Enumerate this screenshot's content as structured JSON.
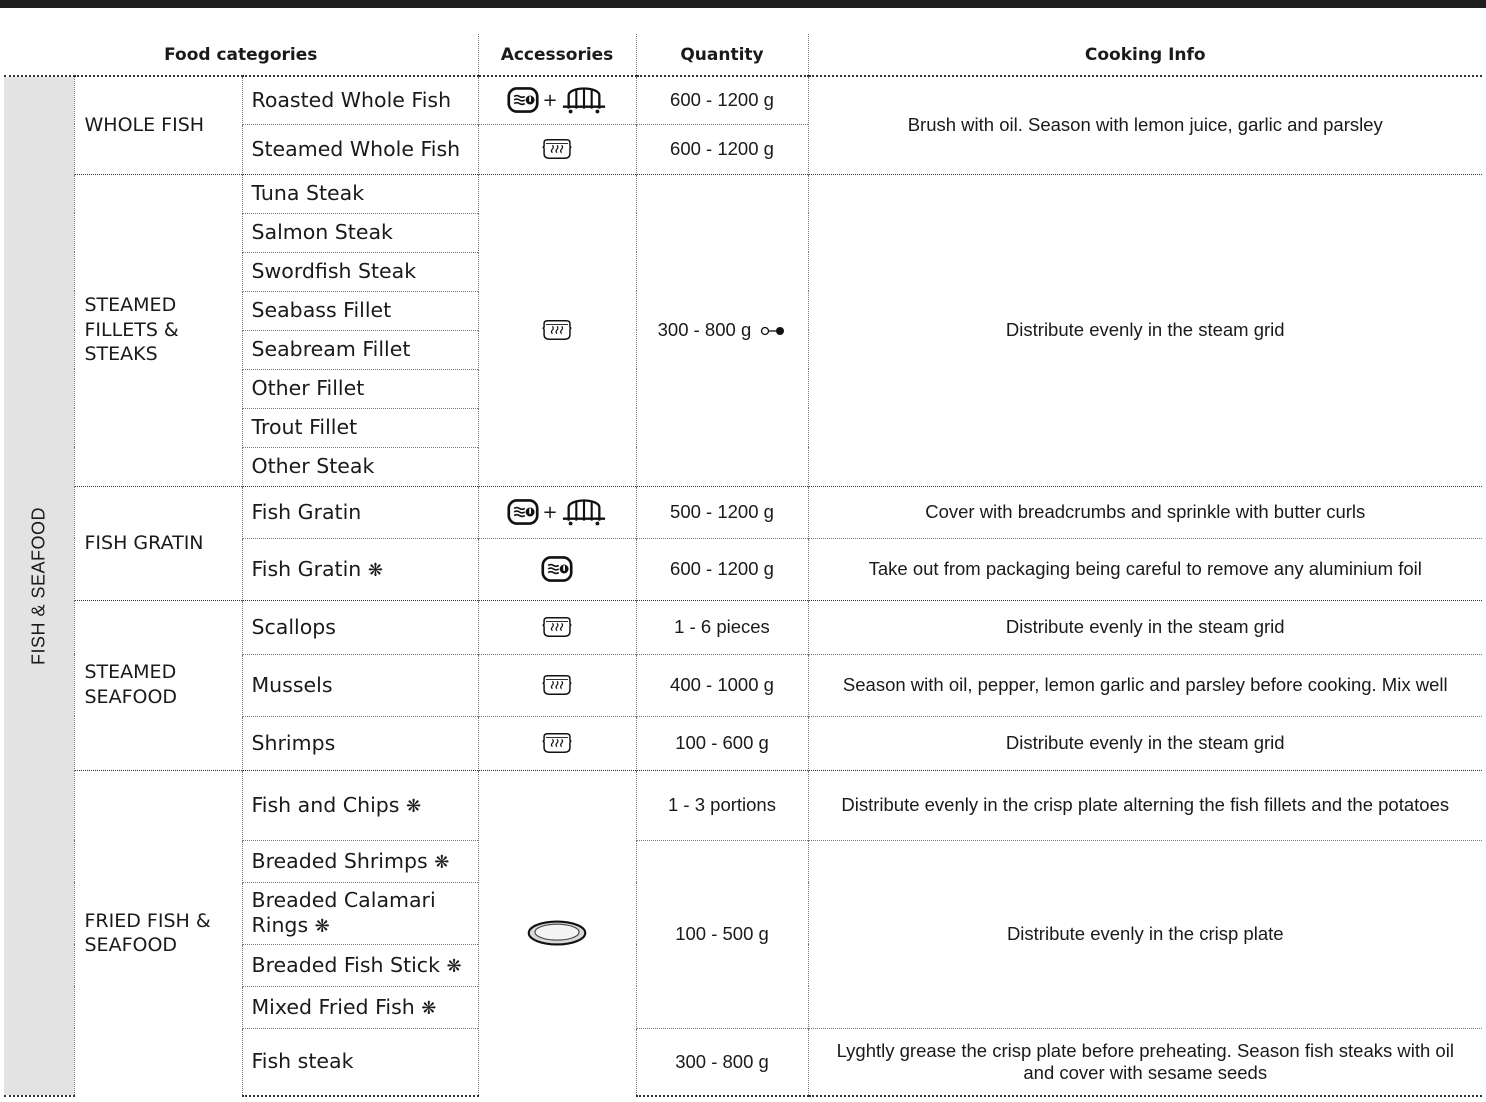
{
  "header": {
    "food_categories": "Food categories",
    "accessories": "Accessories",
    "quantity": "Quantity",
    "cooking_info": "Cooking Info"
  },
  "section_label": "FISH & SEAFOOD",
  "snowflake": "❋",
  "plus": "+",
  "categories": {
    "whole_fish": "WHOLE FISH",
    "steamed_fillets": "STEAMED FILLETS & STEAKS",
    "fish_gratin": "FISH GRATIN",
    "steamed_seafood": "STEAMED SEAFOOD",
    "fried_fish": "FRIED FISH & SEAFOOD"
  },
  "foods": {
    "roasted_whole_fish": "Roasted Whole Fish",
    "steamed_whole_fish": "Steamed Whole Fish",
    "tuna_steak": "Tuna Steak",
    "salmon_steak": "Salmon Steak",
    "swordfish_steak": "Swordfish Steak",
    "seabass_fillet": "Seabass Fillet",
    "seabream_fillet": "Seabream Fillet",
    "other_fillet": "Other Fillet",
    "trout_fillet": "Trout Fillet",
    "other_steak": "Other Steak",
    "fish_gratin": "Fish Gratin",
    "fish_gratin_frozen": "Fish Gratin",
    "scallops": "Scallops",
    "mussels": "Mussels",
    "shrimps": "Shrimps",
    "fish_and_chips": "Fish and Chips",
    "breaded_shrimps": "Breaded Shrimps",
    "breaded_calamari": "Breaded Calamari Rings",
    "breaded_fish_stick": "Breaded Fish Stick",
    "mixed_fried_fish": "Mixed Fried Fish",
    "fish_steak": "Fish steak"
  },
  "quantities": {
    "whole_roasted": "600 - 1200 g",
    "whole_steamed": "600 - 1200  g",
    "fillets": "300 - 800 g",
    "gratin": "500 - 1200 g",
    "gratin_frozen": "600 - 1200 g",
    "scallops": "1 - 6 pieces",
    "mussels": "400 - 1000 g",
    "shrimps": "100 - 600 g",
    "fish_and_chips": "1 - 3 portions",
    "breaded": "100 - 500 g",
    "fish_steak": "300 - 800 g"
  },
  "info": {
    "whole_fish": "Brush with oil. Season with lemon juice, garlic and parsley",
    "fillets": "Distribute evenly in the steam grid",
    "gratin": "Cover with breadcrumbs and sprinkle with butter curls",
    "gratin_frozen": "Take out from packaging being careful to remove any aluminium foil",
    "scallops": "Distribute evenly in the steam grid",
    "mussels": "Season with oil, pepper, lemon garlic and parsley before cooking. Mix well",
    "shrimps": "Distribute evenly in the steam grid",
    "fish_and_chips": "Distribute evenly in the crisp plate alterning the fish fillets and the potatoes",
    "breaded": "Distribute evenly in the crisp plate",
    "fish_steak": "Lyghtly grease the crisp plate before preheating. Season fish steaks with oil and cover with sesame seeds"
  },
  "icons": {
    "dish_plus_rack": [
      "baking-dish-icon",
      "rack-icon"
    ],
    "steamer": "steamer-icon",
    "dish": "baking-dish-icon",
    "crisp_plate": "crisp-plate-icon",
    "preheat": "preheat-icon",
    "frozen": "snowflake-icon"
  }
}
